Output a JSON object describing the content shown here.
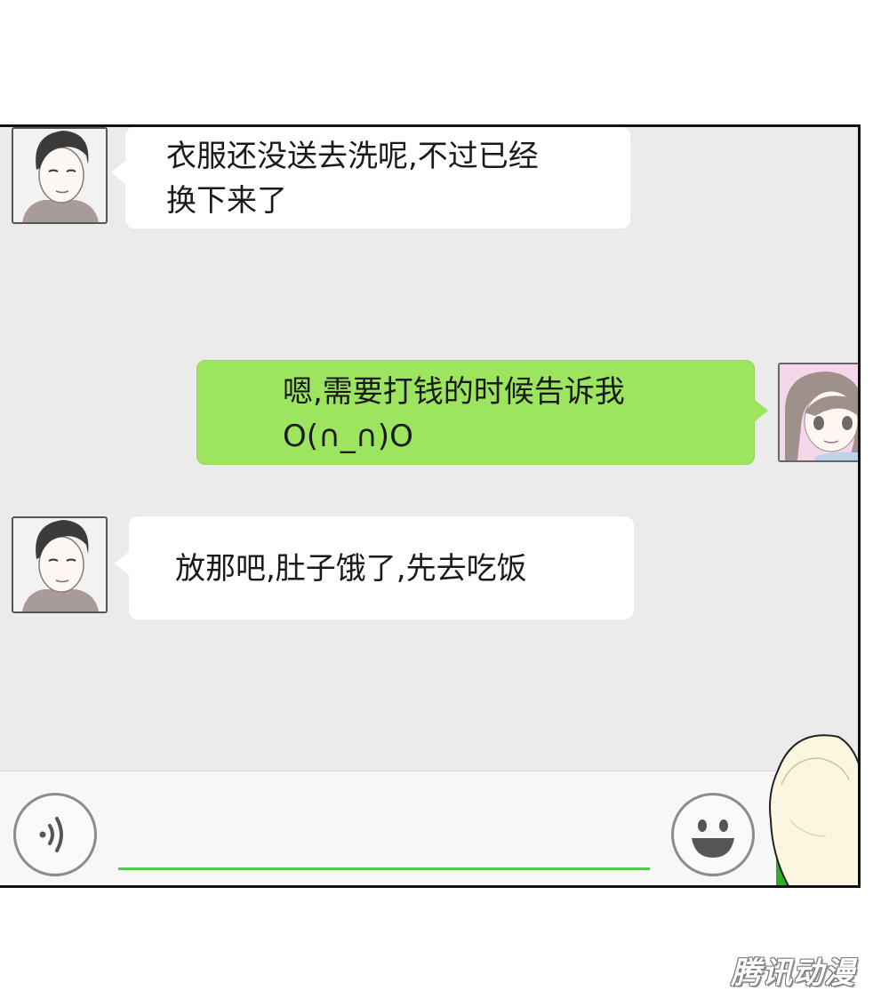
{
  "colors": {
    "chat_background": "#ebebeb",
    "incoming_bubble": "#ffffff",
    "outgoing_bubble": "#9de55f",
    "input_underline": "#55c94a",
    "send_button": "#2cae2c"
  },
  "messages": [
    {
      "sender": "contact",
      "avatar": "male-avatar",
      "lines": [
        "衣服还没送去洗呢,不过已经",
        "换下来了"
      ]
    },
    {
      "sender": "me",
      "avatar": "female-avatar",
      "lines": [
        "嗯,需要打钱的时候告诉我",
        "O(∩_∩)O"
      ]
    },
    {
      "sender": "contact",
      "avatar": "male-avatar",
      "lines": [
        "放那吧,肚子饿了,先去吃饭"
      ]
    }
  ],
  "input_bar": {
    "voice_icon": "voice-wave-icon",
    "emoji_icon": "smiley-icon",
    "input_value": ""
  },
  "watermark": "腾讯动漫"
}
